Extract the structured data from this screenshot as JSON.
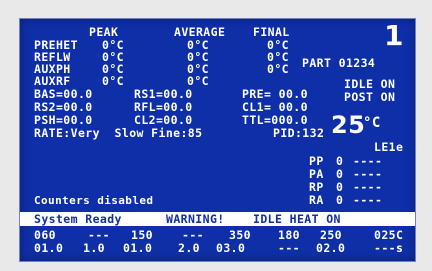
{
  "header": {
    "col_peak": "PEAK",
    "col_average": "AVERAGE",
    "col_final": "FINAL"
  },
  "rows": [
    {
      "label": "PREHET",
      "peak": "0°C",
      "avg": "0°C",
      "final": "0°C"
    },
    {
      "label": "REFLW",
      "peak": "0°C",
      "avg": "0°C",
      "final": "0°C"
    },
    {
      "label": "AUXPH",
      "peak": "0°C",
      "avg": "0°C",
      "final": "0°C"
    },
    {
      "label": "AUXRF",
      "peak": "0°C",
      "avg": "0°C",
      "final": ""
    }
  ],
  "params": {
    "bas": "BAS=00.0",
    "rs1": "RS1=00.0",
    "pre": "PRE= 00.0",
    "rs2": "RS2=00.0",
    "rfl": "RFL=00.0",
    "cl1": "CL1= 00.0",
    "psh": "PSH=00.0",
    "cl2": "CL2=00.0",
    "ttl": "TTL=000.0",
    "rate": "RATE:Very  Slow Fine:85",
    "pid": "PID:132"
  },
  "right_panel": {
    "big_number": "1",
    "part": "PART 01234",
    "idle_on": "IDLE ON",
    "post_on": "POST ON",
    "temperature": "25",
    "temp_unit": "°C",
    "le_code": "LE1e"
  },
  "counters": [
    {
      "label": "PP",
      "value": "0",
      "dashes": "----"
    },
    {
      "label": "PA",
      "value": "0",
      "dashes": "----"
    },
    {
      "label": "RP",
      "value": "0",
      "dashes": "----"
    },
    {
      "label": "RA",
      "value": "0",
      "dashes": "----"
    }
  ],
  "counters_status": "Counters disabled",
  "status_bar": {
    "left": "System Ready",
    "warning": "WARNING!",
    "right": "IDLE HEAT ON"
  },
  "bottom_row1": [
    "060",
    "---",
    "150",
    "---",
    "350",
    "180",
    "250",
    "025C"
  ],
  "bottom_row2": [
    "01.0",
    "1.0",
    "01.0",
    "2.0",
    "03.0",
    "---",
    "02.0",
    "---s"
  ],
  "colors": {
    "screen_bg": "#0f2fa8",
    "text": "#ffffff",
    "status_bar_bg": "#ffffff"
  }
}
